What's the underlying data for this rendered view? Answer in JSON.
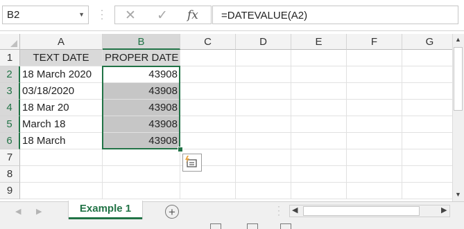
{
  "name_box": {
    "value": "B2"
  },
  "formula_bar": {
    "cancel_glyph": "✕",
    "enter_glyph": "✓",
    "fx_label": "fx",
    "formula": "=DATEVALUE(A2)"
  },
  "columns": [
    "A",
    "B",
    "C",
    "D",
    "E",
    "F",
    "G"
  ],
  "rows": [
    "1",
    "2",
    "3",
    "4",
    "5",
    "6",
    "7",
    "8",
    "9"
  ],
  "cells": {
    "A1": "TEXT DATE",
    "B1": "PROPER DATE",
    "A2": "18 March 2020",
    "A3": "03/18/2020",
    "A4": "18 Mar 20",
    "A5": "March 18",
    "A6": "18 March",
    "B2": "43908",
    "B3": "43908",
    "B4": "43908",
    "B5": "43908",
    "B6": "43908"
  },
  "selection": {
    "active": "B2",
    "range": "B2:B6"
  },
  "sheet_tabs": [
    {
      "label": "Example 1",
      "active": true
    }
  ],
  "add_sheet_label": "+",
  "colors": {
    "accent": "#217346",
    "header_bg": "#f3f3f3",
    "selected_fill": "#c6c6c6"
  },
  "icons": {
    "name_box_dropdown": "chevron-down-icon",
    "cancel": "close-icon",
    "enter": "check-icon",
    "function": "fx-icon",
    "quick_analysis": "quick-analysis-icon",
    "add_sheet": "plus-circle-icon"
  }
}
